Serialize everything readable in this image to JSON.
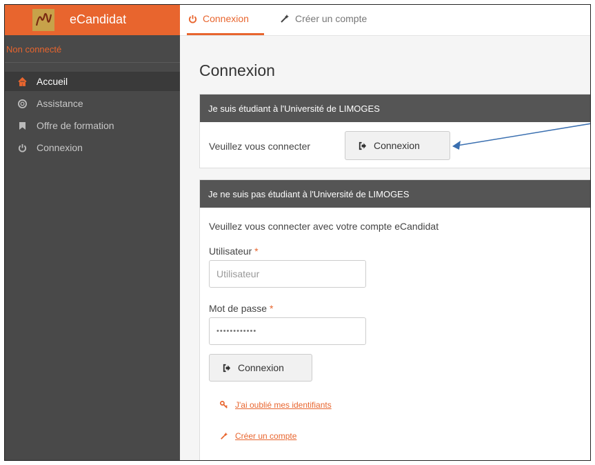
{
  "app": {
    "name": "eCandidat"
  },
  "sidebar": {
    "status": "Non connecté",
    "items": [
      {
        "label": "Accueil",
        "icon": "home-icon",
        "active": true
      },
      {
        "label": "Assistance",
        "icon": "lifebuoy-icon",
        "active": false
      },
      {
        "label": "Offre de formation",
        "icon": "bookmark-icon",
        "active": false
      },
      {
        "label": "Connexion",
        "icon": "power-icon",
        "active": false
      }
    ]
  },
  "tabs": [
    {
      "label": "Connexion",
      "icon": "power-icon",
      "active": true
    },
    {
      "label": "Créer un compte",
      "icon": "magic-wand-icon",
      "active": false
    }
  ],
  "page": {
    "title": "Connexion"
  },
  "student_panel": {
    "header": "Je suis étudiant à l'Université de LIMOGES",
    "prompt": "Veuillez vous connecter",
    "button_label": "Connexion"
  },
  "external_panel": {
    "header": "Je ne suis pas étudiant à l'Université de LIMOGES",
    "prompt": "Veuillez vous connecter avec votre compte eCandidat",
    "user_label": "Utilisateur",
    "user_placeholder": "Utilisateur",
    "password_label": "Mot de passe",
    "password_value": "••••••••••••",
    "required_mark": "*",
    "button_label": "Connexion",
    "forgot_link": "J'ai oublié mes identifiants",
    "create_link": "Créer un compte"
  },
  "colors": {
    "accent": "#e8652e",
    "sidebar": "#494949",
    "panel_header": "#555555",
    "arrow": "#3a6fb0"
  }
}
